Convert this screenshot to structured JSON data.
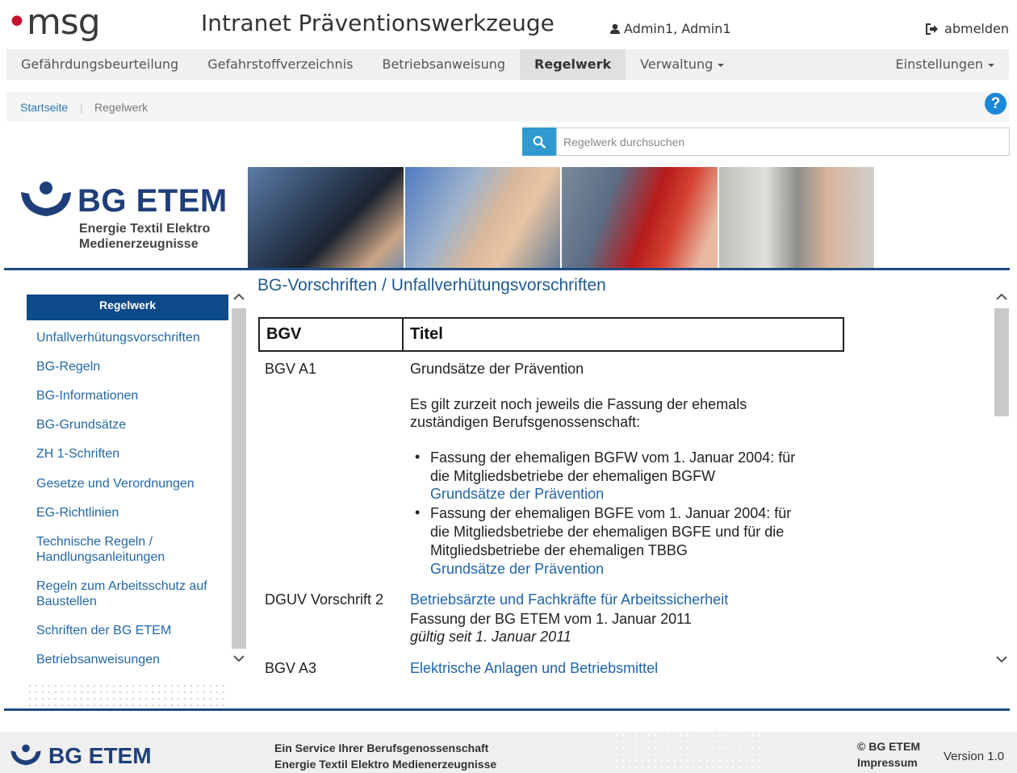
{
  "header": {
    "brand": "msg",
    "app_title": "Intranet Präventionswerkzeuge",
    "user": "Admin1, Admin1",
    "logout": "abmelden"
  },
  "nav": {
    "items": [
      {
        "label": "Gefährdungsbeurteilung"
      },
      {
        "label": "Gefahrstoffverzeichnis"
      },
      {
        "label": "Betriebsanweisung"
      },
      {
        "label": "Regelwerk",
        "active": true
      },
      {
        "label": "Verwaltung"
      }
    ],
    "settings": "Einstellungen"
  },
  "breadcrumb": {
    "home": "Startseite",
    "separator": "|",
    "current": "Regelwerk"
  },
  "search": {
    "placeholder": "Regelwerk durchsuchen"
  },
  "banner": {
    "org_name": "BG ETEM",
    "org_sub1": "Energie Textil Elektro",
    "org_sub2": "Medienerzeugnisse"
  },
  "sidebar": {
    "heading": "Regelwerk",
    "items": [
      {
        "label": "Unfallverhütungsvorschriften"
      },
      {
        "label": "BG-Regeln"
      },
      {
        "label": "BG-Informationen"
      },
      {
        "label": "BG-Grundsätze"
      },
      {
        "label": "ZH 1-Schriften"
      },
      {
        "label": "Gesetze und Verordnungen"
      },
      {
        "label": "EG-Richtlinien"
      },
      {
        "label": "Technische Regeln / Handlungsanleitungen"
      },
      {
        "label": "Regeln zum Arbeitsschutz auf Baustellen"
      },
      {
        "label": "Schriften der BG ETEM"
      },
      {
        "label": "Betriebsanweisungen"
      }
    ]
  },
  "content": {
    "title": "BG-Vorschriften / Unfallverhütungsvorschriften",
    "col_bgv": "BGV",
    "col_titel": "Titel",
    "row1": {
      "code": "BGV A1",
      "title": "Grundsätze der Prävention",
      "note_line1": "Es gilt zurzeit noch jeweils die Fassung der ehemals",
      "note_line2": "zuständigen Berufsgenossenschaft:",
      "b1_line1": "Fassung der ehemaligen BGFW vom 1. Januar 2004: für",
      "b1_line2": "die Mitgliedsbetriebe der ehemaligen BGFW",
      "b1_link": "Grundsätze der Prävention",
      "b2_line1": "Fassung der ehemaligen BGFE vom 1. Januar 2004: für",
      "b2_line2": "die Mitgliedsbetriebe der ehemaligen BGFE und für die",
      "b2_line3": "Mitgliedsbetriebe der ehemaligen TBBG",
      "b2_link": "Grundsätze der Prävention"
    },
    "row2": {
      "code": "DGUV Vorschrift 2",
      "link": "Betriebsärzte und Fachkräfte für Arbeitssicherheit",
      "line1": "Fassung der BG ETEM vom 1. Januar 2011",
      "line2": "gültig seit 1. Januar 2011"
    },
    "row3": {
      "code": "BGV A3",
      "link": "Elektrische Anlagen und Betriebsmittel"
    }
  },
  "footer": {
    "logo": "BG ETEM",
    "service_line1": "Ein Service Ihrer Berufsgenossenschaft",
    "service_line2": "Energie Textil Elektro Medienerzeugnisse",
    "copyright": "© BG ETEM",
    "impressum": "Impressum",
    "version": "Version 1.0"
  },
  "colors": {
    "accent_blue": "#1f4a85",
    "link_blue": "#2367a8",
    "sidebar_head": "#0d4a8a",
    "search_button": "#2e9ad0"
  },
  "icons": [
    "user-icon",
    "logout-icon",
    "help-icon",
    "search-icon",
    "bg-etem-logo",
    "scroll-up-icon",
    "scroll-down-icon"
  ]
}
